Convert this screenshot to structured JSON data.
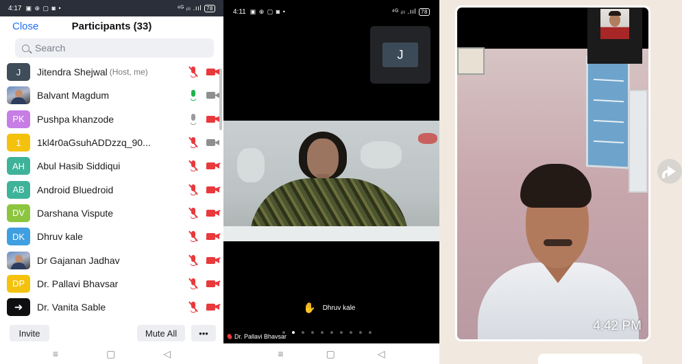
{
  "panel1": {
    "status": {
      "time": "4:17",
      "icons": "▣ ⊕ ▢ ◙ •",
      "signal": "⁴ᴳ ᵢₗₗ .ııl",
      "battery": "78"
    },
    "header": {
      "close_label": "Close",
      "title": "Participants (33)"
    },
    "search": {
      "placeholder": "Search"
    },
    "participants": [
      {
        "initials": "J",
        "avatar_color": "#3f4c5a",
        "name": "Jitendra Shejwal",
        "note": "(Host, me)",
        "mic": "muted",
        "cam": "muted"
      },
      {
        "initials": "",
        "avatar_type": "photo",
        "name": "Balvant Magdum",
        "note": "",
        "mic": "on",
        "cam": "off"
      },
      {
        "initials": "PK",
        "avatar_color": "#c67ee6",
        "name": "Pushpa khanzode",
        "note": "",
        "mic": "off",
        "cam": "muted"
      },
      {
        "initials": "1",
        "avatar_color": "#f4c20d",
        "name": "1kl4r0aGsuhADDzzq_90...",
        "note": "",
        "mic": "muted",
        "cam": "off"
      },
      {
        "initials": "AH",
        "avatar_color": "#3fb39a",
        "name": "Abul Hasib Siddiqui",
        "note": "",
        "mic": "muted",
        "cam": "muted"
      },
      {
        "initials": "AB",
        "avatar_color": "#3fb39a",
        "name": "Android Bluedroid",
        "note": "",
        "mic": "muted",
        "cam": "muted"
      },
      {
        "initials": "DV",
        "avatar_color": "#8cc63f",
        "name": "Darshana Vispute",
        "note": "",
        "mic": "muted",
        "cam": "muted"
      },
      {
        "initials": "DK",
        "avatar_color": "#3f9fe0",
        "name": "Dhruv kale",
        "note": "",
        "mic": "muted",
        "cam": "muted"
      },
      {
        "initials": "",
        "avatar_type": "photo",
        "name": "Dr Gajanan Jadhav",
        "note": "",
        "mic": "muted",
        "cam": "muted"
      },
      {
        "initials": "DP",
        "avatar_color": "#f4c20d",
        "name": "Dr. Pallavi Bhavsar",
        "note": "",
        "mic": "muted",
        "cam": "muted"
      },
      {
        "initials": "➜",
        "avatar_type": "logo",
        "name": "Dr. Vanita Sable",
        "note": "",
        "mic": "muted",
        "cam": "muted"
      }
    ],
    "footer": {
      "invite_label": "Invite",
      "mute_all_label": "Mute All",
      "more_label": "•••"
    },
    "nav": {
      "menu": "≡",
      "home": "▢",
      "back": "◁"
    }
  },
  "panel2": {
    "status": {
      "time": "4:11",
      "icons": "▣ ⊕ ▢ ◙ •",
      "signal": "⁴ᴳ ᵢₗₗ .ııl",
      "battery": "78"
    },
    "thumbnail_initial": "J",
    "raised_hand_name": "Dhruv kale",
    "active_speaker": "Dr. Pallavi Bhavsar",
    "page_dots": 10,
    "active_dot": 1,
    "nav": {
      "menu": "≡",
      "home": "▢",
      "back": "◁"
    }
  },
  "panel3": {
    "timestamp": "4:42 PM"
  }
}
